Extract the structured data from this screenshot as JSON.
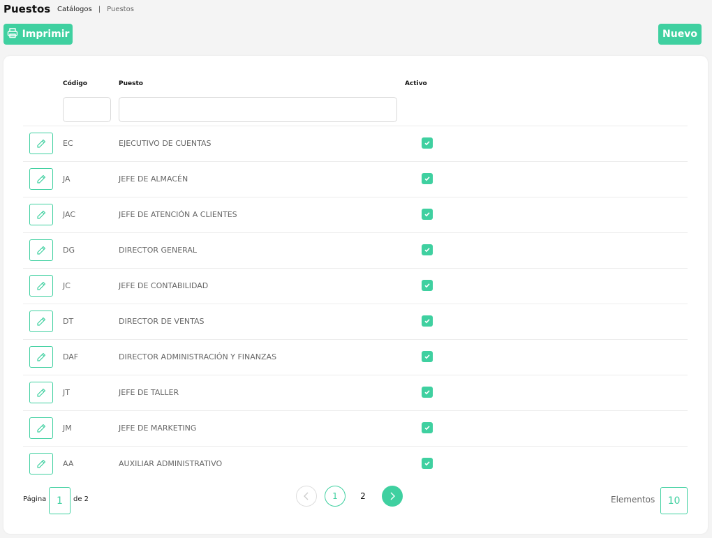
{
  "header": {
    "title": "Puestos",
    "breadcrumb": {
      "parent": "Catálogos",
      "separator": "|",
      "current": "Puestos"
    }
  },
  "toolbar": {
    "print_label": "Imprimir",
    "new_label": "Nuevo"
  },
  "table": {
    "columns": {
      "code": "Código",
      "name": "Puesto",
      "active": "Activo"
    },
    "rows": [
      {
        "code": "EC",
        "name": "EJECUTIVO DE CUENTAS",
        "active": true
      },
      {
        "code": "JA",
        "name": "JEFE DE ALMACÉN",
        "active": true
      },
      {
        "code": "JAC",
        "name": "JEFE DE ATENCIÓN A CLIENTES",
        "active": true
      },
      {
        "code": "DG",
        "name": "DIRECTOR GENERAL",
        "active": true
      },
      {
        "code": "JC",
        "name": "JEFE DE CONTABILIDAD",
        "active": true
      },
      {
        "code": "DT",
        "name": "DIRECTOR DE VENTAS",
        "active": true
      },
      {
        "code": "DAF",
        "name": "DIRECTOR ADMINISTRACIÓN Y FINANZAS",
        "active": true
      },
      {
        "code": "JT",
        "name": "JEFE DE TALLER",
        "active": true
      },
      {
        "code": "JM",
        "name": "JEFE DE MARKETING",
        "active": true
      },
      {
        "code": "AA",
        "name": "AUXILIAR ADMINISTRATIVO",
        "active": true
      }
    ]
  },
  "pagination": {
    "page_label": "Página",
    "current_page": "1",
    "of_label": "de 2",
    "pages": [
      "1",
      "2"
    ],
    "elements_label": "Elementos",
    "elements_value": "10"
  },
  "colors": {
    "accent": "#3fd0a0",
    "background": "#f4f4f4"
  },
  "icons": {
    "print": "printer-icon",
    "edit": "pencil-icon",
    "check": "checkmark-icon",
    "prev": "chevron-left-icon",
    "next": "chevron-right-icon"
  }
}
